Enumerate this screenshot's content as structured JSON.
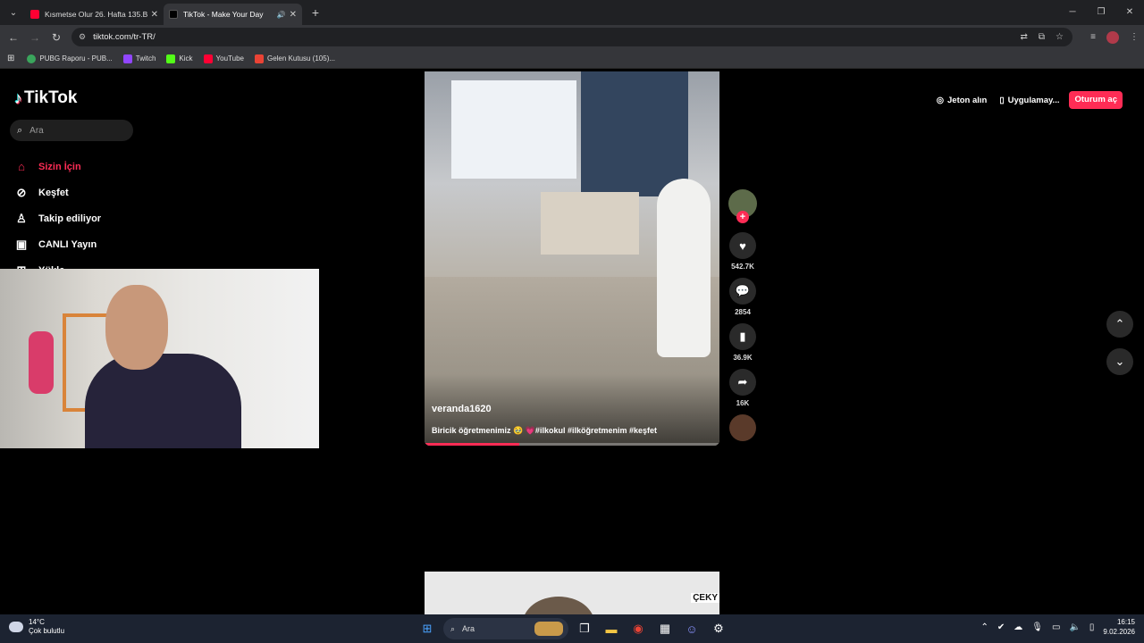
{
  "browser": {
    "tabs": [
      {
        "title": "Kısmetse Olur 26. Hafta 135.Bö",
        "favicon_color": "#ff0033",
        "active": false,
        "has_sound": false
      },
      {
        "title": "TikTok - Make Your Day",
        "favicon_color": "#000000",
        "active": true,
        "has_sound": true
      }
    ],
    "new_tab": "+",
    "url": "tiktok.com/tr-TR/",
    "bookmarks": [
      {
        "label": "PUBG Raporu - PUB...",
        "color": "#3aa55c"
      },
      {
        "label": "Twitch",
        "color": "#9146ff"
      },
      {
        "label": "Kick",
        "color": "#53fc18"
      },
      {
        "label": "YouTube",
        "color": "#ff0033"
      },
      {
        "label": "Gelen Kutusu (105)...",
        "color": "#ea4335"
      }
    ]
  },
  "tiktok": {
    "logo": "TikTok",
    "search_placeholder": "Ara",
    "menu": [
      {
        "label": "Sizin İçin",
        "icon": "home-icon",
        "glyph": "⌂",
        "active": true
      },
      {
        "label": "Keşfet",
        "icon": "compass-icon",
        "glyph": "⊘",
        "active": false
      },
      {
        "label": "Takip ediliyor",
        "icon": "person-follow-icon",
        "glyph": "♙",
        "active": false
      },
      {
        "label": "CANLI Yayın",
        "icon": "live-tv-icon",
        "glyph": "▣",
        "active": false
      },
      {
        "label": "Yükle",
        "icon": "upload-icon",
        "glyph": "⊞",
        "active": false
      }
    ],
    "top_right": {
      "coins": "Jeton alın",
      "app": "Uygulamay...",
      "login": "Oturum aç"
    },
    "video": {
      "author": "veranda1620",
      "description": "Biricik öğretmenimiz 🥹 💗#ilkokul #ilköğretmenim #keşfet",
      "progress": 0.32
    },
    "actions": {
      "likes": "542.7K",
      "comments": "2854",
      "saves": "36.9K",
      "shares": "16K"
    },
    "next_video_tag": "ÇEKY"
  },
  "taskbar": {
    "temperature": "14°C",
    "weather": "Çok bulutlu",
    "search_placeholder": "Ara",
    "time": "16:15",
    "date": "9.02.2026"
  }
}
